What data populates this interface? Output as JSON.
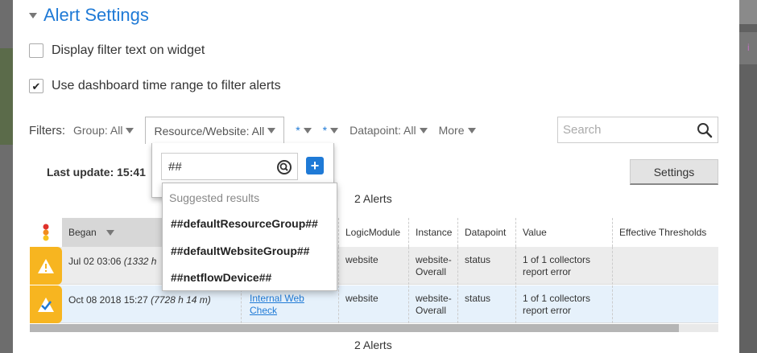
{
  "background": {
    "right_text": "i"
  },
  "section": {
    "title": "Alert Settings"
  },
  "options": {
    "display_filter_text": {
      "label": "Display filter text on widget",
      "checked": false
    },
    "use_dashboard_time": {
      "label": "Use dashboard time range to filter alerts",
      "checked": true,
      "check_glyph": "✔"
    }
  },
  "filters": {
    "label": "Filters:",
    "group": "Group: All",
    "resource": "Resource/Website: All",
    "star1": "*",
    "star2": "*",
    "datapoint": "Datapoint: All",
    "more": "More"
  },
  "search": {
    "placeholder": "Search"
  },
  "popup": {
    "input_value": "##",
    "add_label": "+",
    "suggest_header": "Suggested results",
    "suggestions": [
      "##defaultResourceGroup##",
      "##defaultWebsiteGroup##",
      "##netflowDevice##"
    ]
  },
  "last_update": "Last update: 15:41",
  "settings_button": "Settings",
  "alert_count_top": "2 Alerts",
  "alert_count_bottom": "2 Alerts",
  "table": {
    "headers": {
      "began": "Began",
      "logicmodule": "LogicModule",
      "instance": "Instance",
      "datapoint": "Datapoint",
      "value": "Value",
      "thresholds": "Effective Thresholds"
    },
    "rows": [
      {
        "began": "Jul 02 03:06",
        "began_duration": "(1332 h",
        "resource": "",
        "logicmodule": "website",
        "instance_1": "website-",
        "instance_2": "Overall",
        "datapoint": "status",
        "value_1": "1 of 1 collectors",
        "value_2": "report error",
        "severity_icon": "warning-icon",
        "severity_color": "#f7b520"
      },
      {
        "began": "Oct 08 2018 15:27",
        "began_duration": "(7728 h 14 m)",
        "resource_1": "Internal Web",
        "resource_2": "Check",
        "logicmodule": "website",
        "instance_1": "website-",
        "instance_2": "Overall",
        "datapoint": "status",
        "value_1": "1 of 1 collectors",
        "value_2": "report error",
        "severity_icon": "acknowledged-icon",
        "severity_color": "#f7b520"
      }
    ]
  },
  "colors": {
    "accent": "#1f7ad6",
    "warning": "#f7b520",
    "selected_row": "#e6f1fb"
  }
}
